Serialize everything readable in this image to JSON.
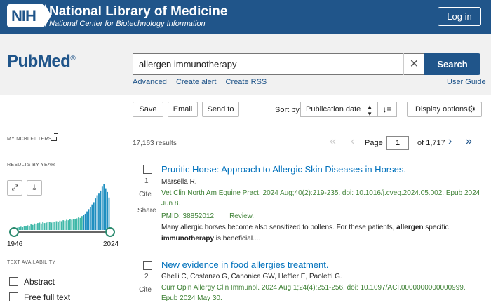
{
  "header": {
    "badge": "NIH",
    "title": "National Library of Medicine",
    "subtitle": "National Center for Biotechnology Information",
    "login_label": "Log in",
    "color": "#20558a"
  },
  "search": {
    "logo_pub": "Pub",
    "logo_med": "Med",
    "logo_reg": "®",
    "query": "allergen immunotherapy",
    "clear_icon": "close-icon",
    "button_label": "Search",
    "links": [
      "Advanced",
      "Create alert",
      "Create RSS"
    ],
    "user_guide": "User Guide"
  },
  "toolbar": {
    "save": "Save",
    "email": "Email",
    "send_to": "Send to",
    "sort_by_label": "Sort by:",
    "sort_value": "Publication date",
    "display_options": "Display options"
  },
  "sidebar": {
    "my_filters": "MY NCBI FILTERS",
    "results_by_year": "RESULTS BY YEAR",
    "year_start": "1946",
    "year_end": "2024",
    "text_availability": "TEXT AVAILABILITY",
    "filters": [
      "Abstract",
      "Free full text"
    ],
    "year_bars_relative": [
      0.05,
      0.06,
      0.07,
      0.06,
      0.08,
      0.09,
      0.1,
      0.09,
      0.12,
      0.11,
      0.14,
      0.13,
      0.15,
      0.16,
      0.14,
      0.17,
      0.15,
      0.16,
      0.18,
      0.17,
      0.16,
      0.18,
      0.17,
      0.19,
      0.18,
      0.2,
      0.19,
      0.21,
      0.2,
      0.22,
      0.21,
      0.23,
      0.22,
      0.24,
      0.23,
      0.25,
      0.27,
      0.26,
      0.3,
      0.32,
      0.35,
      0.4,
      0.45,
      0.5,
      0.55,
      0.6,
      0.68,
      0.75,
      0.8,
      0.85,
      0.95,
      1.0,
      0.9,
      0.82,
      0.7
    ]
  },
  "results": {
    "count": "17,163 results",
    "page_label": "Page",
    "page_value": "1",
    "of_label": "of 1,717",
    "cite_label": "Cite",
    "share_label": "Share",
    "items": [
      {
        "num": "1",
        "title": "Pruritic Horse: Approach to Allergic Skin Diseases in Horses.",
        "authors": "Marsella R.",
        "citation": "Vet Clin North Am Equine Pract. 2024 Aug;40(2):219-235. doi: 10.1016/j.cveq.2024.05.002. Epub 2024 Jun 8.",
        "pmid": "PMID: 38852012",
        "type": "Review.",
        "snippet_pre": "Many allergic horses become also sensitized to pollens. For these patients, ",
        "snippet_b1": "allergen",
        "snippet_mid": " specific ",
        "snippet_b2": "immunotherapy",
        "snippet_post": " is beneficial...."
      },
      {
        "num": "2",
        "title": "New evidence in food allergies treatment.",
        "authors": "Ghelli C, Costanzo G, Canonica GW, Heffler E, Paoletti G.",
        "citation": "Curr Opin Allergy Clin Immunol. 2024 Aug 1;24(4):251-256. doi: 10.1097/ACI.0000000000000999. Epub 2024 May 30."
      }
    ]
  }
}
